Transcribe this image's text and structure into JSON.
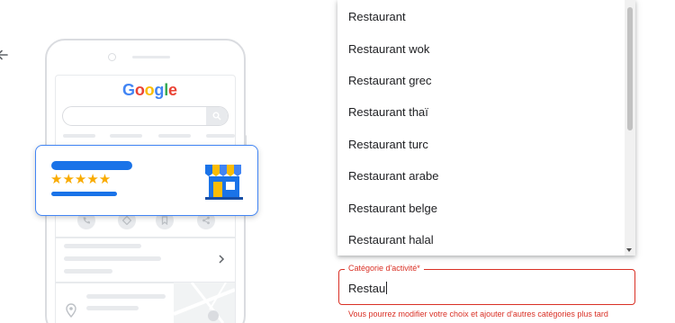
{
  "phone_illustration": {
    "logo_letters": [
      {
        "char": "G",
        "color": "#4285f4"
      },
      {
        "char": "o",
        "color": "#ea4335"
      },
      {
        "char": "o",
        "color": "#fbbc05"
      },
      {
        "char": "g",
        "color": "#4285f4"
      },
      {
        "char": "l",
        "color": "#34a853"
      },
      {
        "char": "e",
        "color": "#ea4335"
      }
    ],
    "business_card": {
      "stars": "★★★★★",
      "rating": 5,
      "star_color": "#f9ab00",
      "accent_color": "#1a73e8"
    }
  },
  "dropdown": {
    "items": [
      "Restaurant",
      "Restaurant wok",
      "Restaurant grec",
      "Restaurant thaï",
      "Restaurant turc",
      "Restaurant arabe",
      "Restaurant belge",
      "Restaurant halal"
    ]
  },
  "category_field": {
    "label": "Catégorie d'activité*",
    "value": "Restau",
    "helper_text": "Vous pourrez modifier votre choix et ajouter d'autres catégories plus tard",
    "error_color": "#d93025"
  },
  "icons": {
    "back": "arrow-left-icon",
    "search": "search-icon",
    "shop": "storefront-icon",
    "chevron": "chevron-right-icon",
    "pin": "location-pin-icon"
  }
}
